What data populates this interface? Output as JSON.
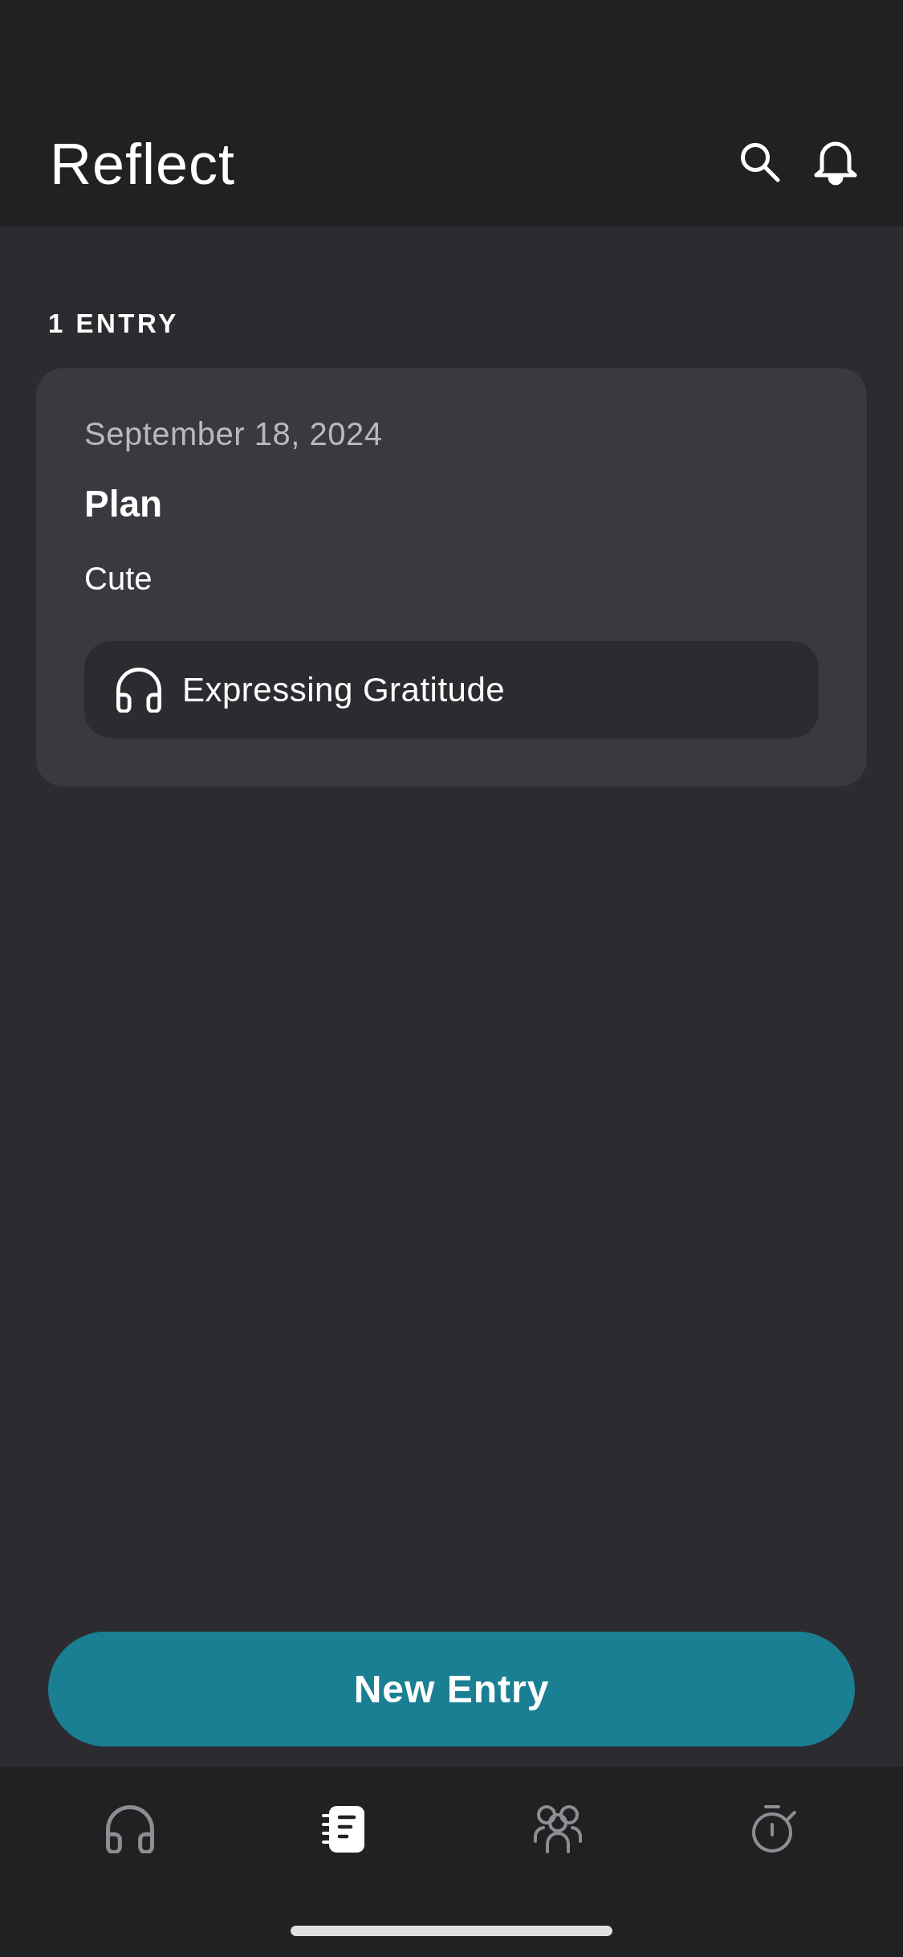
{
  "header": {
    "title": "Reflect"
  },
  "entries_count": "1 ENTRY",
  "entries": [
    {
      "date": "September 18, 2024",
      "title": "Plan",
      "body": "Cute",
      "session": {
        "label": "Expressing Gratitude"
      }
    }
  ],
  "new_entry_button": {
    "label": "New Entry"
  },
  "tab_bar": {
    "tabs": [
      {
        "kind": "listen",
        "selected": false
      },
      {
        "kind": "journal",
        "selected": true
      },
      {
        "kind": "community",
        "selected": false
      },
      {
        "kind": "timer",
        "selected": false
      }
    ]
  }
}
